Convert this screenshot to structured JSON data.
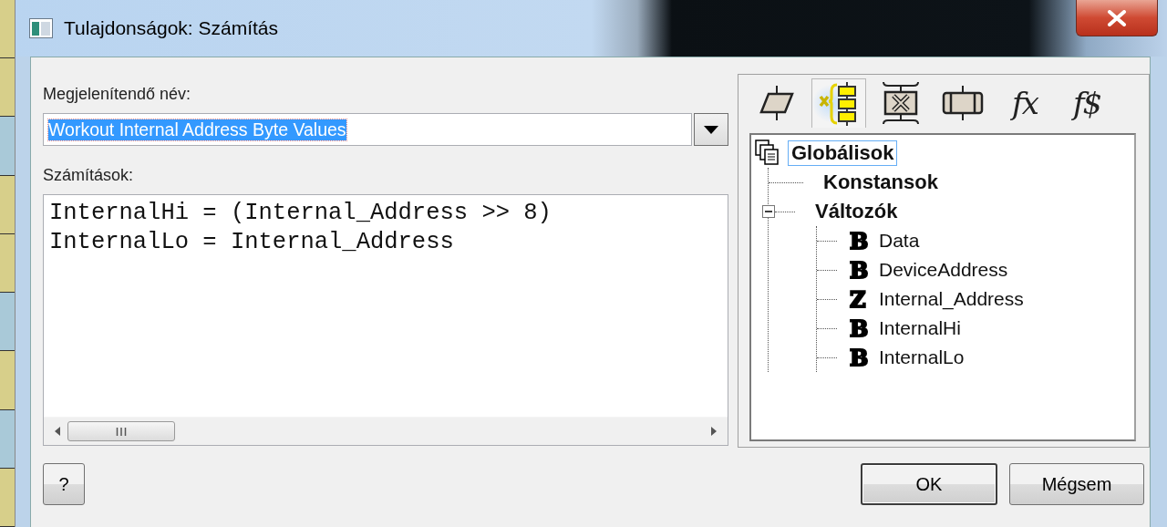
{
  "window": {
    "title": "Tulajdonságok: Számítás"
  },
  "display_name": {
    "label": "Megjelenítendő név:",
    "value": "Workout Internal Address Byte Values",
    "text_selected": true
  },
  "calculations": {
    "label": "Számítások:",
    "lines": [
      "InternalHi = (Internal_Address >> 8)",
      "InternalLo = Internal_Address"
    ]
  },
  "toolbar": [
    {
      "kind": "parallelogram",
      "selected": false
    },
    {
      "kind": "variables",
      "selected": true
    },
    {
      "kind": "crossed-box",
      "selected": false
    },
    {
      "kind": "process",
      "selected": false
    },
    {
      "kind": "glyph",
      "label": "fx",
      "selected": false
    },
    {
      "kind": "glyph",
      "label": "f$",
      "selected": false
    }
  ],
  "tree": [
    {
      "label": "Globálisok",
      "kind": "group",
      "selected": true,
      "children": [
        {
          "label": "Konstansok",
          "kind": "category",
          "selected": false
        },
        {
          "label": "Változók",
          "kind": "category",
          "selected": false,
          "expanded": true,
          "children": [
            {
              "label": "Data",
              "kind": "variable",
              "type": "𝔹",
              "selected": false
            },
            {
              "label": "DeviceAddress",
              "kind": "variable",
              "type": "𝔹",
              "selected": false
            },
            {
              "label": "Internal_Address",
              "kind": "variable",
              "type": "ℤ",
              "selected": false
            },
            {
              "label": "InternalHi",
              "kind": "variable",
              "type": "𝔹",
              "selected": false
            },
            {
              "label": "InternalLo",
              "kind": "variable",
              "type": "𝔹",
              "selected": false
            }
          ]
        }
      ]
    }
  ],
  "help_button": {
    "label": "?"
  },
  "buttons": [
    {
      "label": "OK",
      "default": true
    },
    {
      "label": "Mégsem",
      "default": false
    }
  ]
}
